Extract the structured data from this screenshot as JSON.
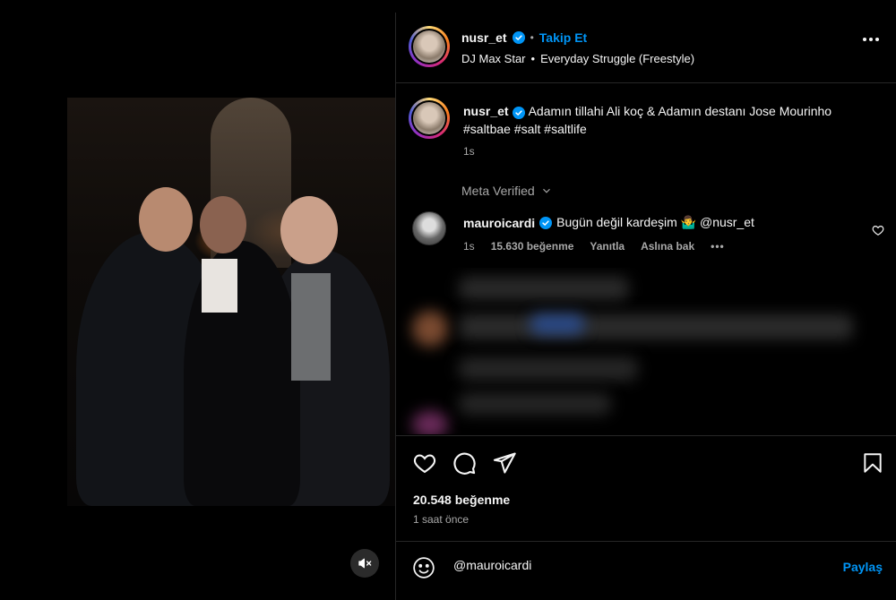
{
  "colors": {
    "accent": "#0095f6",
    "background": "#000000",
    "text": "#f5f5f5",
    "muted": "#a8a8a8",
    "divider": "#262626"
  },
  "header": {
    "username": "nusr_et",
    "separator": "•",
    "follow_label": "Takip Et",
    "audio_artist": "DJ Max Star",
    "audio_separator": "•",
    "audio_title": "Everyday Struggle (Freestyle)",
    "more_icon": "more-horizontal-icon"
  },
  "caption": {
    "username": "nusr_et",
    "text": "Adamın tillahi Ali koç & Adamın destanı Jose Mourinho #saltbae #salt #saltlife",
    "time": "1s"
  },
  "meta_verified": {
    "label": "Meta Verified",
    "icon": "chevron-down-icon"
  },
  "comment": {
    "username": "mauroicardi",
    "text": "Bugün değil kardeşim 🤷‍♂ @nusr_et",
    "time": "1s",
    "likes": "15.630 beğenme",
    "reply_label": "Yanıtla",
    "translate_label": "Aslına bak",
    "like_icon": "heart-icon"
  },
  "actions": {
    "like_icon": "heart-icon",
    "comment_icon": "comment-icon",
    "share_icon": "send-icon",
    "save_icon": "bookmark-icon",
    "likes": "20.548 beğenme",
    "posted": "1 saat önce"
  },
  "comment_box": {
    "value": "@mauroicardi",
    "emoji_icon": "emoji-icon",
    "submit_label": "Paylaş"
  },
  "media": {
    "mute_icon": "speaker-muted-icon"
  }
}
